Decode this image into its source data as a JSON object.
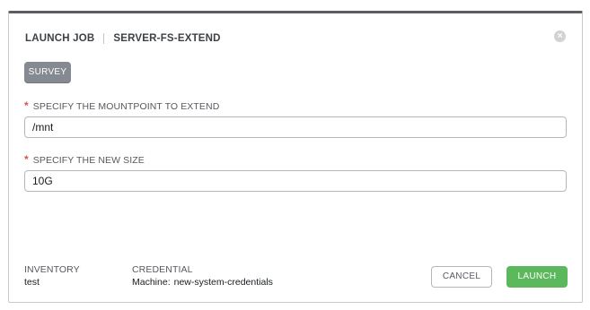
{
  "modal": {
    "title": "LAUNCH JOB",
    "job_name": "SERVER-FS-EXTEND",
    "close_icon": "close-icon"
  },
  "tabs": {
    "survey_label": "SURVEY"
  },
  "fields": [
    {
      "required_marker": "*",
      "label": "SPECIFY THE MOUNTPOINT TO EXTEND",
      "value": "/mnt"
    },
    {
      "required_marker": "*",
      "label": "SPECIFY THE NEW SIZE",
      "value": "10G"
    }
  ],
  "footer": {
    "inventory_label": "INVENTORY",
    "inventory_value": "test",
    "credential_label": "CREDENTIAL",
    "credential_type": "Machine:",
    "credential_value": "new-system-credentials"
  },
  "actions": {
    "cancel_label": "CANCEL",
    "launch_label": "LAUNCH"
  },
  "colors": {
    "launch_button": "#5cb85c",
    "survey_button": "#848992",
    "required_marker": "#d9534f"
  }
}
